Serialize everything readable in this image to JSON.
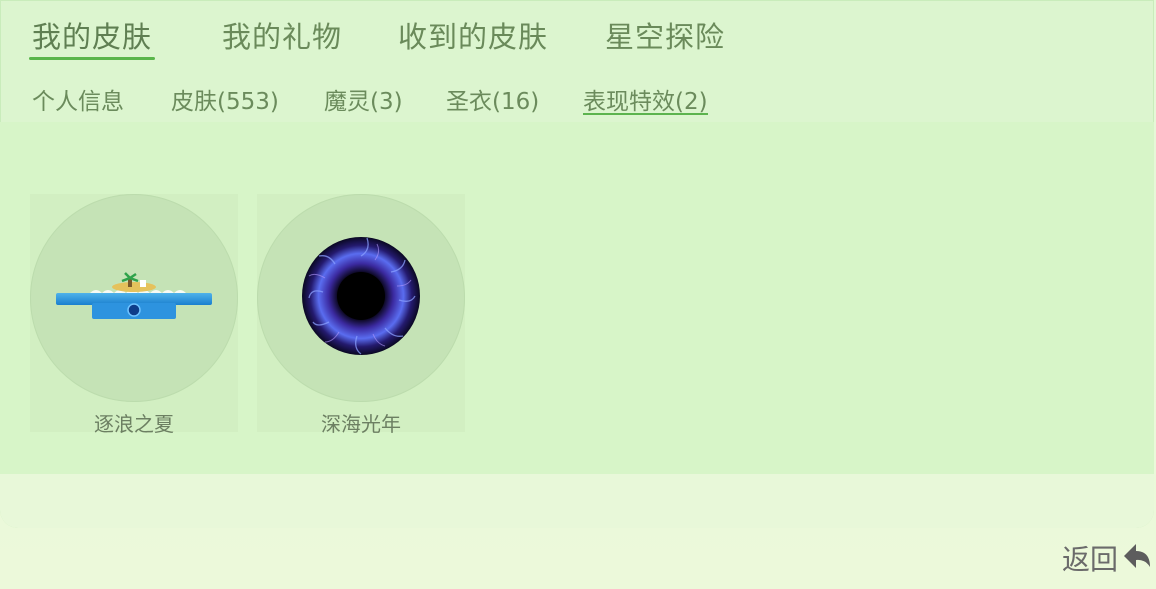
{
  "tabs": [
    {
      "label": "我的皮肤",
      "active": true
    },
    {
      "label": "我的礼物",
      "active": false
    },
    {
      "label": "收到的皮肤",
      "active": false
    },
    {
      "label": "星空探险",
      "active": false
    }
  ],
  "subtabs": [
    {
      "label": "个人信息",
      "active": false
    },
    {
      "label": "皮肤(553)",
      "active": false
    },
    {
      "label": "魔灵(3)",
      "active": false
    },
    {
      "label": "圣衣(16)",
      "active": false
    },
    {
      "label": "表现特效(2)",
      "active": true
    }
  ],
  "effects": [
    {
      "name": "逐浪之夏",
      "icon": "wave-island-icon"
    },
    {
      "name": "深海光年",
      "icon": "blue-vortex-icon"
    }
  ],
  "footer": {
    "back_label": "返回",
    "back_icon": "return-arrow-icon"
  },
  "colors": {
    "accent": "#59b64a",
    "panel": "#dcf5cf",
    "circle": "#c5e3b6"
  }
}
